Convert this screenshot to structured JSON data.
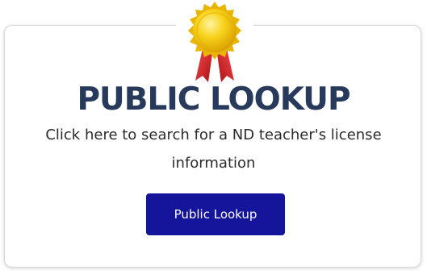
{
  "card": {
    "title": "PUBLIC LOOKUP",
    "description": "Click here to search for a ND teacher's license information",
    "button_label": "Public Lookup",
    "badge_icon": "award-ribbon-icon"
  },
  "colors": {
    "title": "#283a5b",
    "button": "#15159c",
    "button_text": "#ffffff",
    "medal_gold": "#f5c400",
    "ribbon_red": "#d61f26"
  }
}
